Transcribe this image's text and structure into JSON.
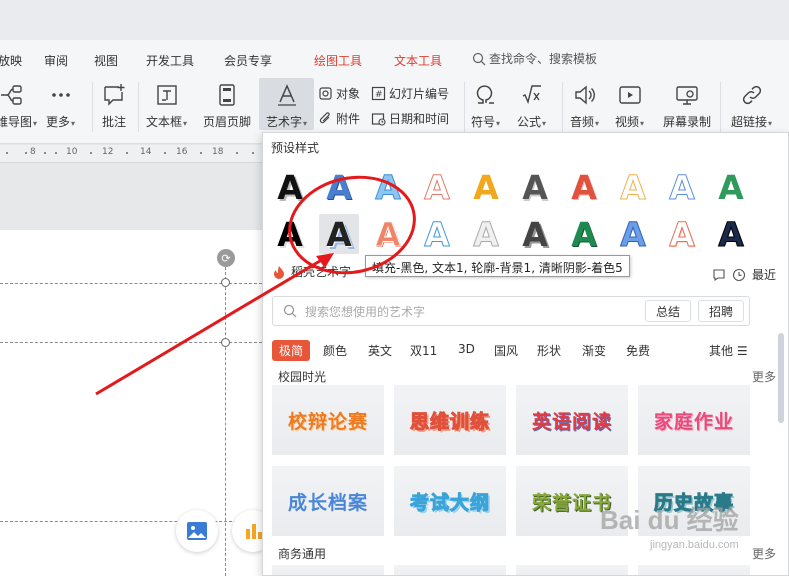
{
  "menubar": {
    "items": [
      "放映",
      "审阅",
      "视图",
      "开发工具",
      "会员专享",
      "绘图工具",
      "文本工具"
    ],
    "search": "查找命令、搜索模板",
    "highlight_color": "#e23b2f"
  },
  "ribbon": {
    "buttons": [
      {
        "label": "思维导图",
        "icon": "mindmap-icon",
        "has_dropdown": true
      },
      {
        "label": "更多",
        "icon": "more-dots-icon",
        "has_dropdown": true
      },
      {
        "label": "批注",
        "icon": "comment-icon"
      },
      {
        "label": "文本框",
        "icon": "textbox-icon",
        "has_dropdown": true
      },
      {
        "label": "页眉页脚",
        "icon": "header-footer-icon"
      },
      {
        "label": "艺术字",
        "icon": "wordart-icon",
        "has_dropdown": true,
        "active": true
      },
      {
        "label": "符号",
        "icon": "omega-icon",
        "has_dropdown": true
      },
      {
        "label": "公式",
        "icon": "formula-icon",
        "has_dropdown": true
      },
      {
        "label": "音频",
        "icon": "audio-icon",
        "has_dropdown": true
      },
      {
        "label": "视频",
        "icon": "video-icon",
        "has_dropdown": true
      },
      {
        "label": "屏幕录制",
        "icon": "screen-record-icon"
      },
      {
        "label": "超链接",
        "icon": "hyperlink-icon",
        "has_dropdown": true
      }
    ],
    "small": [
      {
        "label": "对象",
        "icon": "object-icon"
      },
      {
        "label": "附件",
        "icon": "attachment-icon"
      },
      {
        "label": "幻灯片编号",
        "icon": "slide-number-icon"
      },
      {
        "label": "日期和时间",
        "icon": "date-time-icon"
      }
    ]
  },
  "ruler": {
    "ticks": [
      "8",
      "10",
      "12",
      "14",
      "16",
      "18"
    ]
  },
  "popup": {
    "title": "预设样式",
    "tooltip": "填充-黑色, 文本1, 轮廓-背景1, 清晰阴影-着色5",
    "sub_label": "稻壳艺术字",
    "recent": "最近",
    "search_placeholder": "搜索您想使用的艺术字",
    "pills": [
      "总结",
      "招聘"
    ],
    "categories": [
      "极简",
      "颜色",
      "英文",
      "双11",
      "3D",
      "国风",
      "形状",
      "渐变",
      "免费"
    ],
    "other": "其他",
    "sections": [
      {
        "title": "校园时光",
        "more": "更多",
        "cards": [
          "校辩论赛",
          "思维训练",
          "英语阅读",
          "家庭作业",
          "成长档案",
          "考试大纲",
          "荣誉证书",
          "历史故事"
        ]
      },
      {
        "title": "商务通用",
        "more": "更多"
      }
    ]
  },
  "watermark": {
    "text": "Bai du 经验",
    "sub": "jingyan.baidu.com"
  },
  "colors": {
    "accent": "#e8563a",
    "annotation": "#e3191c"
  }
}
